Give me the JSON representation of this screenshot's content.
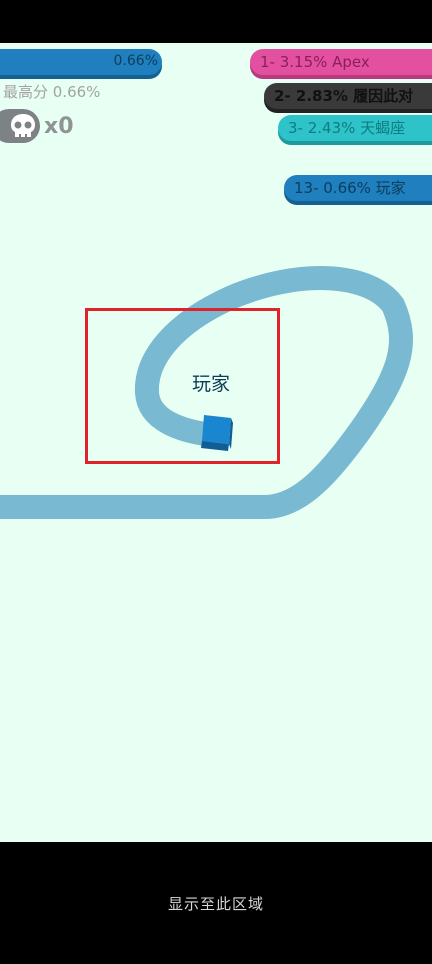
{
  "hud": {
    "my_percent": "0.66%",
    "best_score_label": "最高分 0.66%",
    "kills_count": "x0"
  },
  "leaderboard": [
    {
      "rank_text": "1- 3.15% Apex",
      "color": "#e2509f"
    },
    {
      "rank_text": "2- 2.83% 履因此对",
      "color": "#3a3a3a"
    },
    {
      "rank_text": "3- 2.43% 天蝎座",
      "color": "#2dc3c8"
    },
    {
      "rank_text": "13- 0.66% 玩家",
      "color": "#1f7fbf"
    }
  ],
  "player": {
    "name": "玩家",
    "color": "#1a86cf",
    "trail_color": "#79b9d1"
  },
  "footer": {
    "hint": "显示至此区域"
  },
  "colors": {
    "field": "#e8fff4",
    "highlight": "#e0232b"
  }
}
